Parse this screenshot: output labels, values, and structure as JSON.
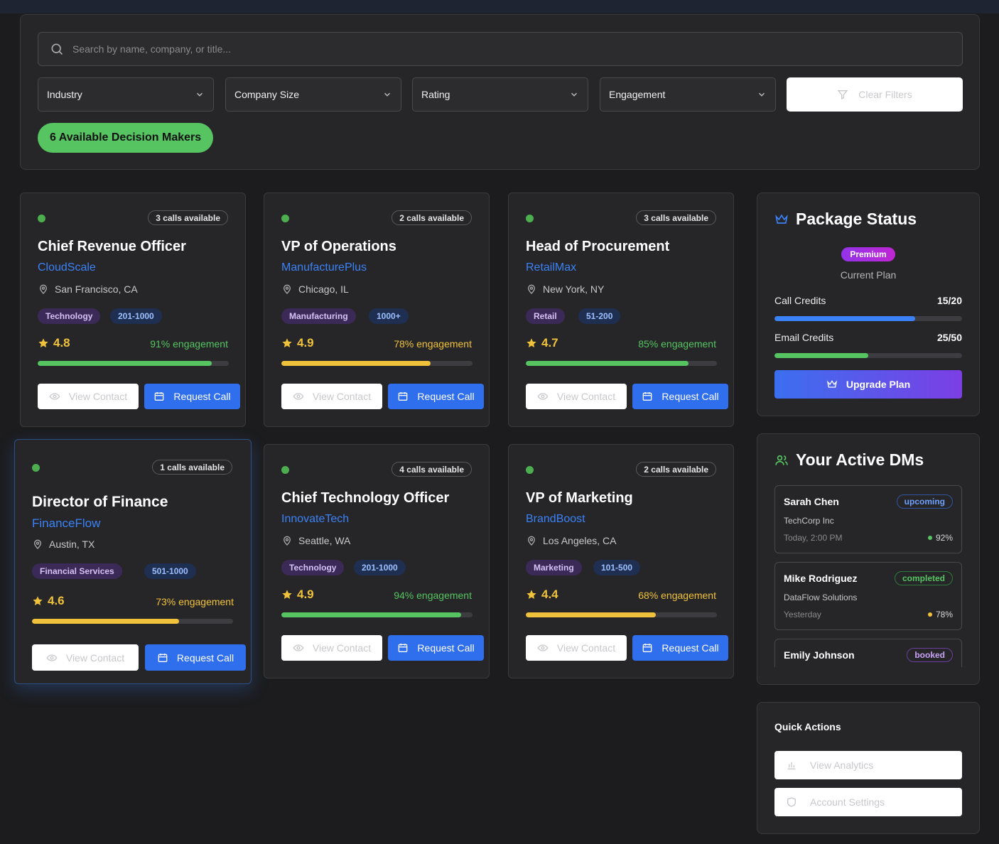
{
  "search": {
    "placeholder": "Search by name, company, or title..."
  },
  "filters": {
    "industry": "Industry",
    "company_size": "Company Size",
    "rating": "Rating",
    "engagement": "Engagement",
    "clear_label": "Clear Filters"
  },
  "available_count_label": "6 Available Decision Makers",
  "colors": {
    "accent_blue": "#3b82f6",
    "green": "#55c461",
    "yellow": "#f0c23b",
    "purple": "#9333ea"
  },
  "cards": [
    {
      "calls": "3 calls available",
      "title": "Chief Revenue Officer",
      "company": "CloudScale",
      "location": "San Francisco, CA",
      "industry": "Technology",
      "size": "201-1000",
      "rating": "4.8",
      "engagement": "91% engagement",
      "engagement_pct": 91,
      "level": "high",
      "view": "View Contact",
      "call": "Request Call"
    },
    {
      "calls": "2 calls available",
      "title": "VP of Operations",
      "company": "ManufacturePlus",
      "location": "Chicago, IL",
      "industry": "Manufacturing",
      "size": "1000+",
      "rating": "4.9",
      "engagement": "78% engagement",
      "engagement_pct": 78,
      "level": "mid",
      "view": "View Contact",
      "call": "Request Call"
    },
    {
      "calls": "3 calls available",
      "title": "Head of Procurement",
      "company": "RetailMax",
      "location": "New York, NY",
      "industry": "Retail",
      "size": "51-200",
      "rating": "4.7",
      "engagement": "85% engagement",
      "engagement_pct": 85,
      "level": "high",
      "view": "View Contact",
      "call": "Request Call"
    },
    {
      "calls": "1 calls available",
      "title": "Director of Finance",
      "company": "FinanceFlow",
      "location": "Austin, TX",
      "industry": "Financial Services",
      "size": "501-1000",
      "rating": "4.6",
      "engagement": "73% engagement",
      "engagement_pct": 73,
      "level": "mid",
      "view": "View Contact",
      "call": "Request Call"
    },
    {
      "calls": "4 calls available",
      "title": "Chief Technology Officer",
      "company": "InnovateTech",
      "location": "Seattle, WA",
      "industry": "Technology",
      "size": "201-1000",
      "rating": "4.9",
      "engagement": "94% engagement",
      "engagement_pct": 94,
      "level": "high",
      "view": "View Contact",
      "call": "Request Call"
    },
    {
      "calls": "2 calls available",
      "title": "VP of Marketing",
      "company": "BrandBoost",
      "location": "Los Angeles, CA",
      "industry": "Marketing",
      "size": "101-500",
      "rating": "4.4",
      "engagement": "68% engagement",
      "engagement_pct": 68,
      "level": "mid",
      "view": "View Contact",
      "call": "Request Call"
    }
  ],
  "package": {
    "title": "Package Status",
    "badge": "Premium",
    "plan_label": "Current Plan",
    "call_credits_label": "Call Credits",
    "call_credits": "15/20",
    "call_credits_fraction": 0.75,
    "email_credits_label": "Email Credits",
    "email_credits": "25/50",
    "email_credits_fraction": 0.5,
    "upgrade_label": "Upgrade Plan"
  },
  "active_dms": {
    "title": "Your Active DMs",
    "items": [
      {
        "name": "Sarah Chen",
        "status": "upcoming",
        "company": "TechCorp Inc",
        "when": "Today, 2:00 PM",
        "pct": "92%"
      },
      {
        "name": "Mike Rodriguez",
        "status": "completed",
        "company": "DataFlow Solutions",
        "when": "Yesterday",
        "pct": "78%"
      },
      {
        "name": "Emily Johnson",
        "status": "booked"
      }
    ]
  },
  "quick_actions": {
    "title": "Quick Actions",
    "analytics": "View Analytics",
    "settings": "Account Settings"
  }
}
